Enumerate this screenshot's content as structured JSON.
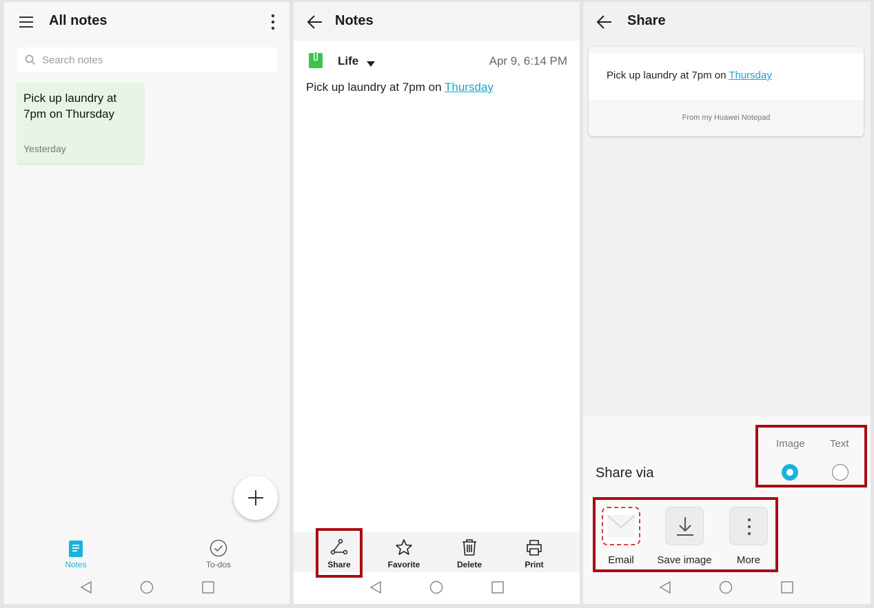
{
  "panel1": {
    "title": "All notes",
    "search_placeholder": "Search notes",
    "note": {
      "text": "Pick up laundry at 7pm on Thursday",
      "date": "Yesterday"
    },
    "tabs": [
      {
        "label": "Notes",
        "icon": "note-icon",
        "active": true
      },
      {
        "label": "To-dos",
        "icon": "check-circle-icon",
        "active": false
      }
    ],
    "accent": "#1ab3d8"
  },
  "panel2": {
    "title": "Notes",
    "category": "Life",
    "timestamp": "Apr 9, 6:14 PM",
    "body_prefix": "Pick up laundry at 7pm on ",
    "body_link": "Thursday",
    "actions": [
      {
        "label": "Share",
        "icon": "share-icon",
        "highlighted": true
      },
      {
        "label": "Favorite",
        "icon": "star-icon",
        "highlighted": false
      },
      {
        "label": "Delete",
        "icon": "trash-icon",
        "highlighted": false
      },
      {
        "label": "Print",
        "icon": "printer-icon",
        "highlighted": false
      }
    ],
    "category_color": "#3cc44a"
  },
  "panel3": {
    "title": "Share",
    "preview_prefix": "Pick up laundry at 7pm on ",
    "preview_link": "Thursday",
    "preview_footer": "From my Huawei Notepad",
    "share_via_label": "Share via",
    "format_options": [
      {
        "label": "Image",
        "selected": true
      },
      {
        "label": "Text",
        "selected": false
      }
    ],
    "targets": [
      {
        "label": "Email",
        "icon": "envelope-icon"
      },
      {
        "label": "Save image",
        "icon": "download-icon"
      },
      {
        "label": "More",
        "icon": "more-vertical-icon"
      }
    ],
    "highlight_color": "#a80d13"
  }
}
